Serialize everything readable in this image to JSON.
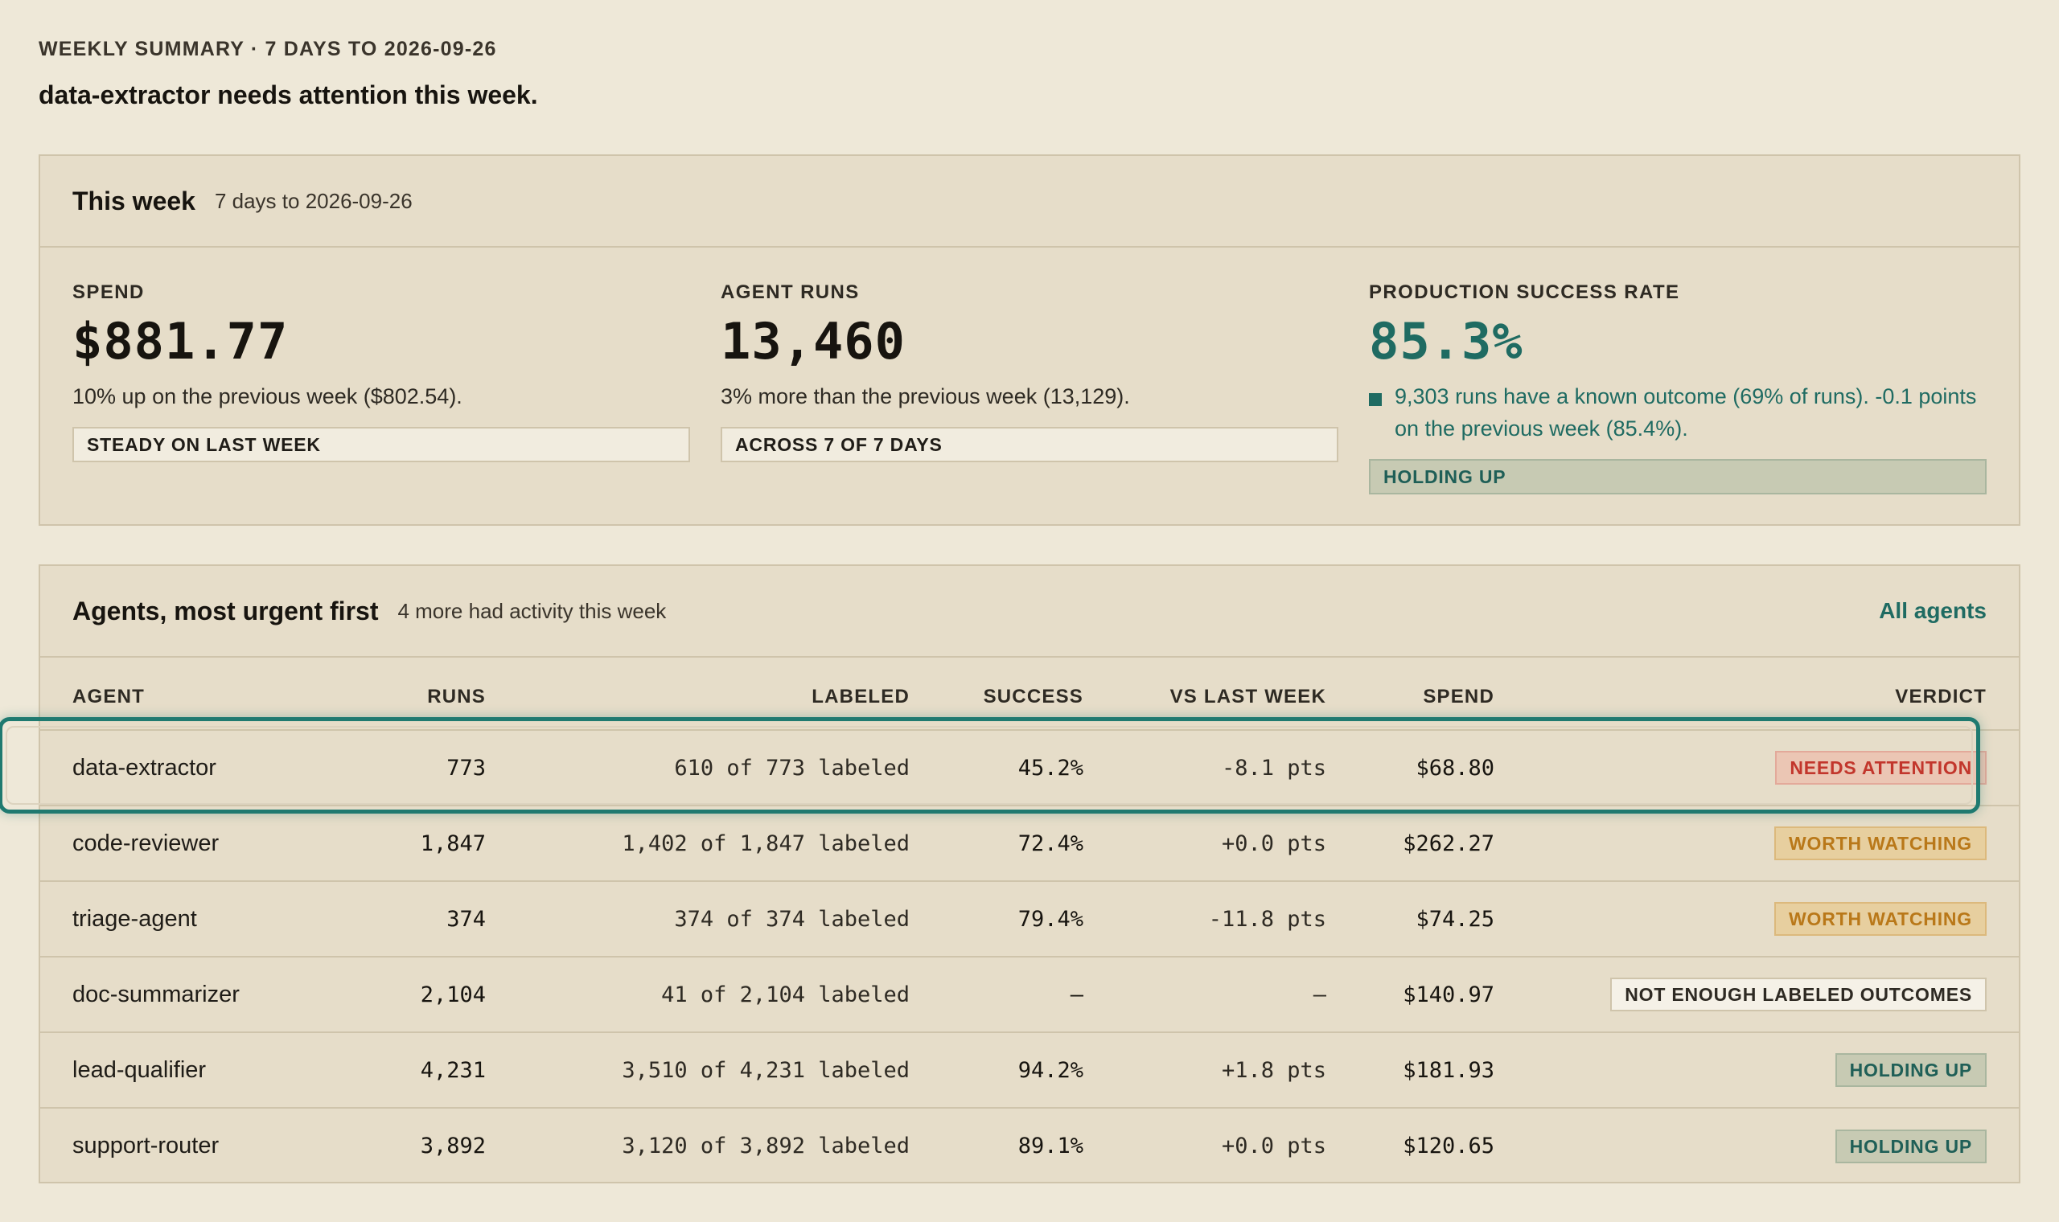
{
  "header": {
    "eyebrow": "WEEKLY SUMMARY · 7 DAYS TO 2026-09-26",
    "headline": "data-extractor needs attention this week."
  },
  "week": {
    "title": "This week",
    "subtitle": "7 days to 2026-09-26",
    "spend": {
      "label": "SPEND",
      "value": "$881.77",
      "note": "10% up on the previous week ($802.54).",
      "tag": "STEADY ON LAST WEEK"
    },
    "runs": {
      "label": "AGENT RUNS",
      "value": "13,460",
      "note": "3% more than the previous week (13,129).",
      "tag": "ACROSS 7 OF 7 DAYS"
    },
    "success": {
      "label": "PRODUCTION SUCCESS RATE",
      "value": "85.3%",
      "note": "9,303 runs have a known outcome (69% of runs). -0.1 points on the previous week (85.4%).",
      "tag": "HOLDING UP",
      "accent": "#1f6b62"
    }
  },
  "agents": {
    "title": "Agents, most urgent first",
    "subtitle": "4 more had activity this week",
    "link": "All agents",
    "columns": {
      "agent": "AGENT",
      "runs": "RUNS",
      "labeled": "LABELED",
      "success": "SUCCESS",
      "vs": "VS LAST WEEK",
      "spend": "SPEND",
      "verdict": "VERDICT"
    },
    "rows": [
      {
        "agent": "data-extractor",
        "runs": "773",
        "labeled": "610 of 773 labeled",
        "success": "45.2%",
        "vs": "-8.1 pts",
        "spend": "$68.80",
        "verdict": "NEEDS ATTENTION",
        "level": "attn"
      },
      {
        "agent": "code-reviewer",
        "runs": "1,847",
        "labeled": "1,402 of 1,847 labeled",
        "success": "72.4%",
        "vs": "+0.0 pts",
        "spend": "$262.27",
        "verdict": "WORTH WATCHING",
        "level": "watch"
      },
      {
        "agent": "triage-agent",
        "runs": "374",
        "labeled": "374 of 374 labeled",
        "success": "79.4%",
        "vs": "-11.8 pts",
        "spend": "$74.25",
        "verdict": "WORTH WATCHING",
        "level": "watch"
      },
      {
        "agent": "doc-summarizer",
        "runs": "2,104",
        "labeled": "41 of 2,104 labeled",
        "success": "—",
        "vs": "—",
        "spend": "$140.97",
        "verdict": "NOT ENOUGH LABELED OUTCOMES",
        "level": "neutral"
      },
      {
        "agent": "lead-qualifier",
        "runs": "4,231",
        "labeled": "3,510 of 4,231 labeled",
        "success": "94.2%",
        "vs": "+1.8 pts",
        "spend": "$181.93",
        "verdict": "HOLDING UP",
        "level": "good"
      },
      {
        "agent": "support-router",
        "runs": "3,892",
        "labeled": "3,120 of 3,892 labeled",
        "success": "89.1%",
        "vs": "+0.0 pts",
        "spend": "$120.65",
        "verdict": "HOLDING UP",
        "level": "good"
      }
    ],
    "focused_row": "data-extractor"
  },
  "colors": {
    "accent": "#1f6b62",
    "attention": "#c2362c",
    "watching": "#b97819",
    "background": "#eee8d8",
    "panel": "#e6ddc9"
  }
}
